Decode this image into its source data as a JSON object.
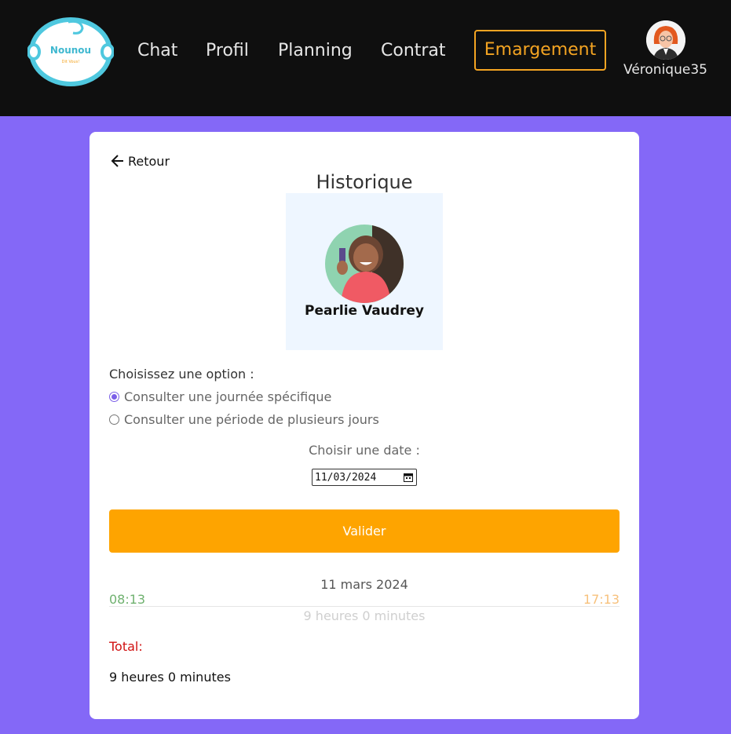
{
  "header": {
    "logo_text": "Nounou",
    "logo_tagline": "Dit Vous!",
    "nav": [
      {
        "label": "Chat"
      },
      {
        "label": "Profil"
      },
      {
        "label": "Planning"
      },
      {
        "label": "Contrat"
      },
      {
        "label": "Emargement",
        "active": true
      }
    ],
    "user": {
      "name": "Véronique35"
    }
  },
  "card": {
    "back_label": "Retour",
    "title": "Historique",
    "child": {
      "name": "Pearlie Vaudrey"
    },
    "options_label": "Choisissez une option :",
    "options": [
      {
        "label": "Consulter une journée spécifique",
        "checked": true
      },
      {
        "label": "Consulter une période de plusieurs jours",
        "checked": false
      }
    ],
    "date_label": "Choisir une date :",
    "date_value": "11/03/2024",
    "validate_label": "Valider",
    "entry": {
      "date": "11 mars 2024",
      "time_in": "08:13",
      "time_out": "17:13",
      "duration": "9 heures 0 minutes"
    },
    "total_label": "Total:",
    "total_value": "9 heures 0 minutes"
  },
  "colors": {
    "background": "#8468f7",
    "header": "#0f0f0f",
    "accent": "#fea400",
    "active_nav": "#f4a422",
    "radio_checked": "#7b5fe8",
    "time_in": "#6fb16f",
    "time_out": "#f7c17c",
    "total_label": "#d01010"
  }
}
